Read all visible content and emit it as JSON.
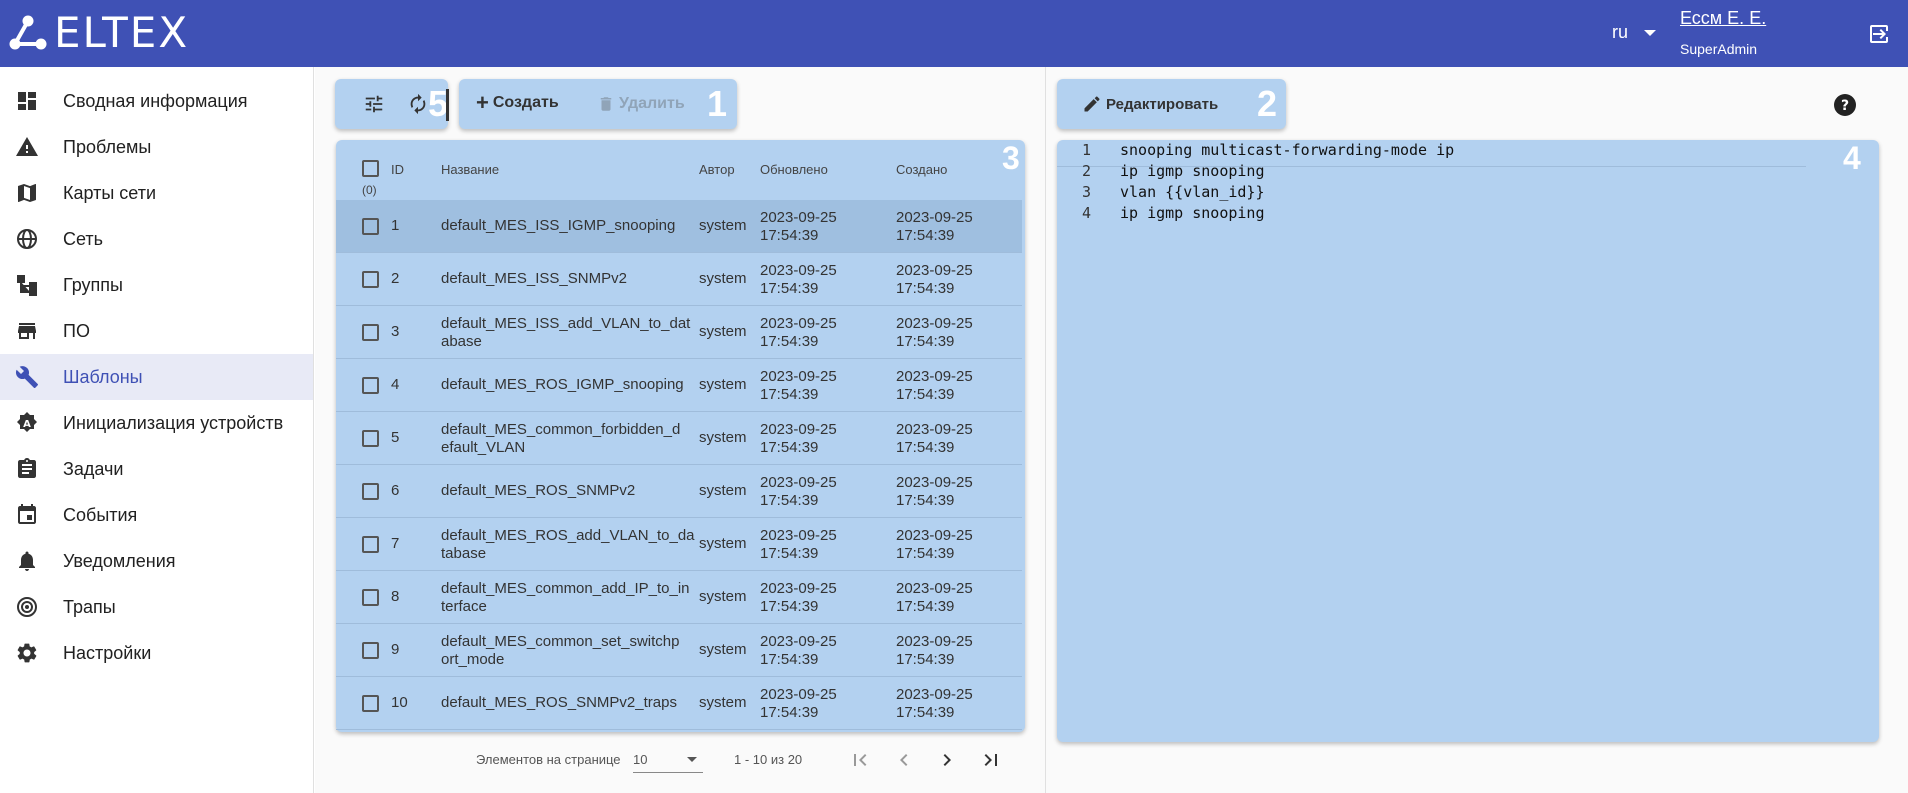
{
  "brand": {
    "logo_text": "ELTEX"
  },
  "header": {
    "language": "ru",
    "user_name": "Ессм Е. Е.",
    "user_role": "SuperAdmin"
  },
  "sidebar": {
    "items": [
      {
        "label": "Сводная информация",
        "icon": "dashboard-icon"
      },
      {
        "label": "Проблемы",
        "icon": "warning-icon"
      },
      {
        "label": "Карты сети",
        "icon": "map-icon"
      },
      {
        "label": "Сеть",
        "icon": "globe-icon"
      },
      {
        "label": "Группы",
        "icon": "hierarchy-icon"
      },
      {
        "label": "ПО",
        "icon": "store-icon"
      },
      {
        "label": "Шаблоны",
        "icon": "wrench-icon",
        "active": true
      },
      {
        "label": "Инициализация устройств",
        "icon": "auto-badge-icon"
      },
      {
        "label": "Задачи",
        "icon": "clipboard-icon"
      },
      {
        "label": "События",
        "icon": "calendar-icon"
      },
      {
        "label": "Уведомления",
        "icon": "bell-icon"
      },
      {
        "label": "Трапы",
        "icon": "target-icon"
      },
      {
        "label": "Настройки",
        "icon": "gear-icon"
      }
    ]
  },
  "toolbar": {
    "create_label": "Создать",
    "delete_label": "Удалить",
    "edit_label": "Редактировать"
  },
  "badges": {
    "b1": "1",
    "b2": "2",
    "b3": "3",
    "b4": "4",
    "b5": "5"
  },
  "table": {
    "columns": {
      "id": "ID",
      "selected": "(0)",
      "name": "Название",
      "author": "Автор",
      "updated": "Обновлено",
      "created": "Создано"
    },
    "rows": [
      {
        "id": "1",
        "name1": "default_MES_ISS_IGMP_snooping",
        "name2": "",
        "author": "system",
        "upd_d": "2023-09-25",
        "upd_t": "17:54:39",
        "cr_d": "2023-09-25",
        "cr_t": "17:54:39"
      },
      {
        "id": "2",
        "name1": "default_MES_ISS_SNMPv2",
        "name2": "",
        "author": "system",
        "upd_d": "2023-09-25",
        "upd_t": "17:54:39",
        "cr_d": "2023-09-25",
        "cr_t": "17:54:39"
      },
      {
        "id": "3",
        "name1": "default_MES_ISS_add_VLAN_to_dat",
        "name2": "abase",
        "author": "system",
        "upd_d": "2023-09-25",
        "upd_t": "17:54:39",
        "cr_d": "2023-09-25",
        "cr_t": "17:54:39"
      },
      {
        "id": "4",
        "name1": "default_MES_ROS_IGMP_snooping",
        "name2": "",
        "author": "system",
        "upd_d": "2023-09-25",
        "upd_t": "17:54:39",
        "cr_d": "2023-09-25",
        "cr_t": "17:54:39"
      },
      {
        "id": "5",
        "name1": "default_MES_common_forbidden_d",
        "name2": "efault_VLAN",
        "author": "system",
        "upd_d": "2023-09-25",
        "upd_t": "17:54:39",
        "cr_d": "2023-09-25",
        "cr_t": "17:54:39"
      },
      {
        "id": "6",
        "name1": "default_MES_ROS_SNMPv2",
        "name2": "",
        "author": "system",
        "upd_d": "2023-09-25",
        "upd_t": "17:54:39",
        "cr_d": "2023-09-25",
        "cr_t": "17:54:39"
      },
      {
        "id": "7",
        "name1": "default_MES_ROS_add_VLAN_to_da",
        "name2": "tabase",
        "author": "system",
        "upd_d": "2023-09-25",
        "upd_t": "17:54:39",
        "cr_d": "2023-09-25",
        "cr_t": "17:54:39"
      },
      {
        "id": "8",
        "name1": "default_MES_common_add_IP_to_in",
        "name2": "terface",
        "author": "system",
        "upd_d": "2023-09-25",
        "upd_t": "17:54:39",
        "cr_d": "2023-09-25",
        "cr_t": "17:54:39"
      },
      {
        "id": "9",
        "name1": "default_MES_common_set_switchp",
        "name2": "ort_mode",
        "author": "system",
        "upd_d": "2023-09-25",
        "upd_t": "17:54:39",
        "cr_d": "2023-09-25",
        "cr_t": "17:54:39"
      },
      {
        "id": "10",
        "name1": "default_MES_ROS_SNMPv2_traps",
        "name2": "",
        "author": "system",
        "upd_d": "2023-09-25",
        "upd_t": "17:54:39",
        "cr_d": "2023-09-25",
        "cr_t": "17:54:39"
      }
    ]
  },
  "pager": {
    "per_page_label": "Элементов на странице",
    "per_page_value": "10",
    "range": "1 - 10 из 20"
  },
  "editor": {
    "lines": [
      {
        "num": "1",
        "text": "snooping multicast-forwarding-mode ip"
      },
      {
        "num": "2",
        "text": "ip igmp snooping"
      },
      {
        "num": "3",
        "text": "vlan {{vlan_id}}"
      },
      {
        "num": "4",
        "text": "ip igmp snooping"
      }
    ]
  },
  "colors": {
    "header": "#3f51b5",
    "highlight": "#b3d1f0",
    "accent": "#3f51b5"
  }
}
